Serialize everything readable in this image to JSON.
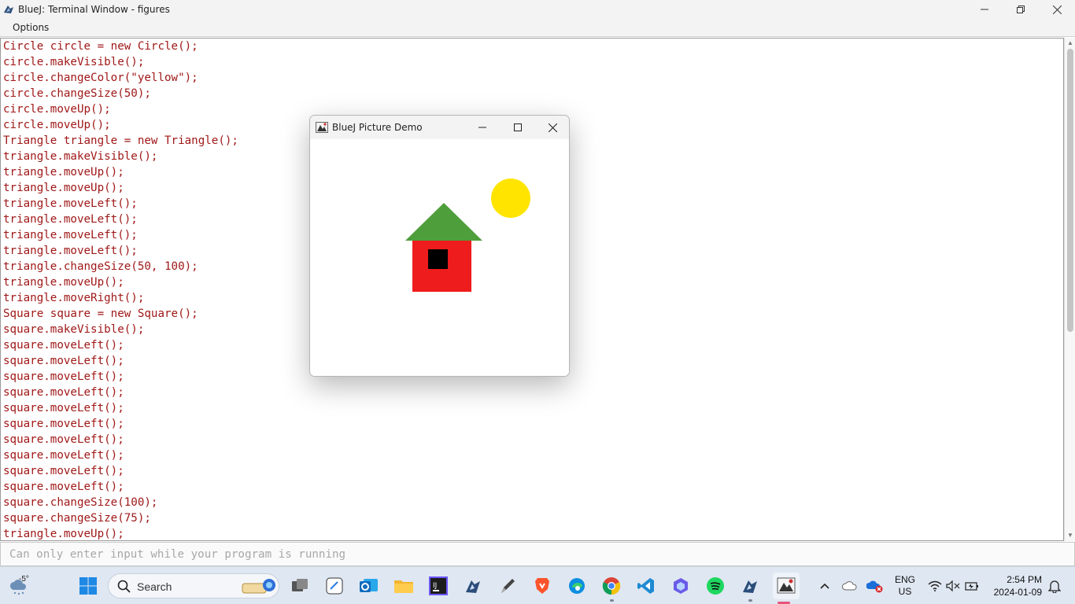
{
  "window": {
    "title": "BlueJ: Terminal Window - figures"
  },
  "menu": {
    "options_label": "Options"
  },
  "terminal": {
    "lines": [
      "Circle circle = new Circle();",
      "circle.makeVisible();",
      "circle.changeColor(\"yellow\");",
      "circle.changeSize(50);",
      "circle.moveUp();",
      "circle.moveUp();",
      "Triangle triangle = new Triangle();",
      "triangle.makeVisible();",
      "triangle.moveUp();",
      "triangle.moveUp();",
      "triangle.moveLeft();",
      "triangle.moveLeft();",
      "triangle.moveLeft();",
      "triangle.moveLeft();",
      "triangle.changeSize(50, 100);",
      "triangle.moveUp();",
      "triangle.moveRight();",
      "Square square = new Square();",
      "square.makeVisible();",
      "square.moveLeft();",
      "square.moveLeft();",
      "square.moveLeft();",
      "square.moveLeft();",
      "square.moveLeft();",
      "square.moveLeft();",
      "square.moveLeft();",
      "square.moveLeft();",
      "square.moveLeft();",
      "square.moveLeft();",
      "square.changeSize(100);",
      "square.changeSize(75);",
      "triangle.moveUp();"
    ],
    "text_color": "#a01818"
  },
  "input": {
    "placeholder": "Can only enter input while your program is running"
  },
  "picture_window": {
    "title": "BlueJ Picture Demo",
    "colors": {
      "sun": "#ffe400",
      "roof": "#4f9e3c",
      "wall": "#ee1c1c",
      "window": "#000000"
    }
  },
  "taskbar": {
    "weather_temp": "-5°",
    "search_label": "Search",
    "language_top": "ENG",
    "language_bottom": "US",
    "time": "2:54 PM",
    "date": "2024-01-09"
  }
}
